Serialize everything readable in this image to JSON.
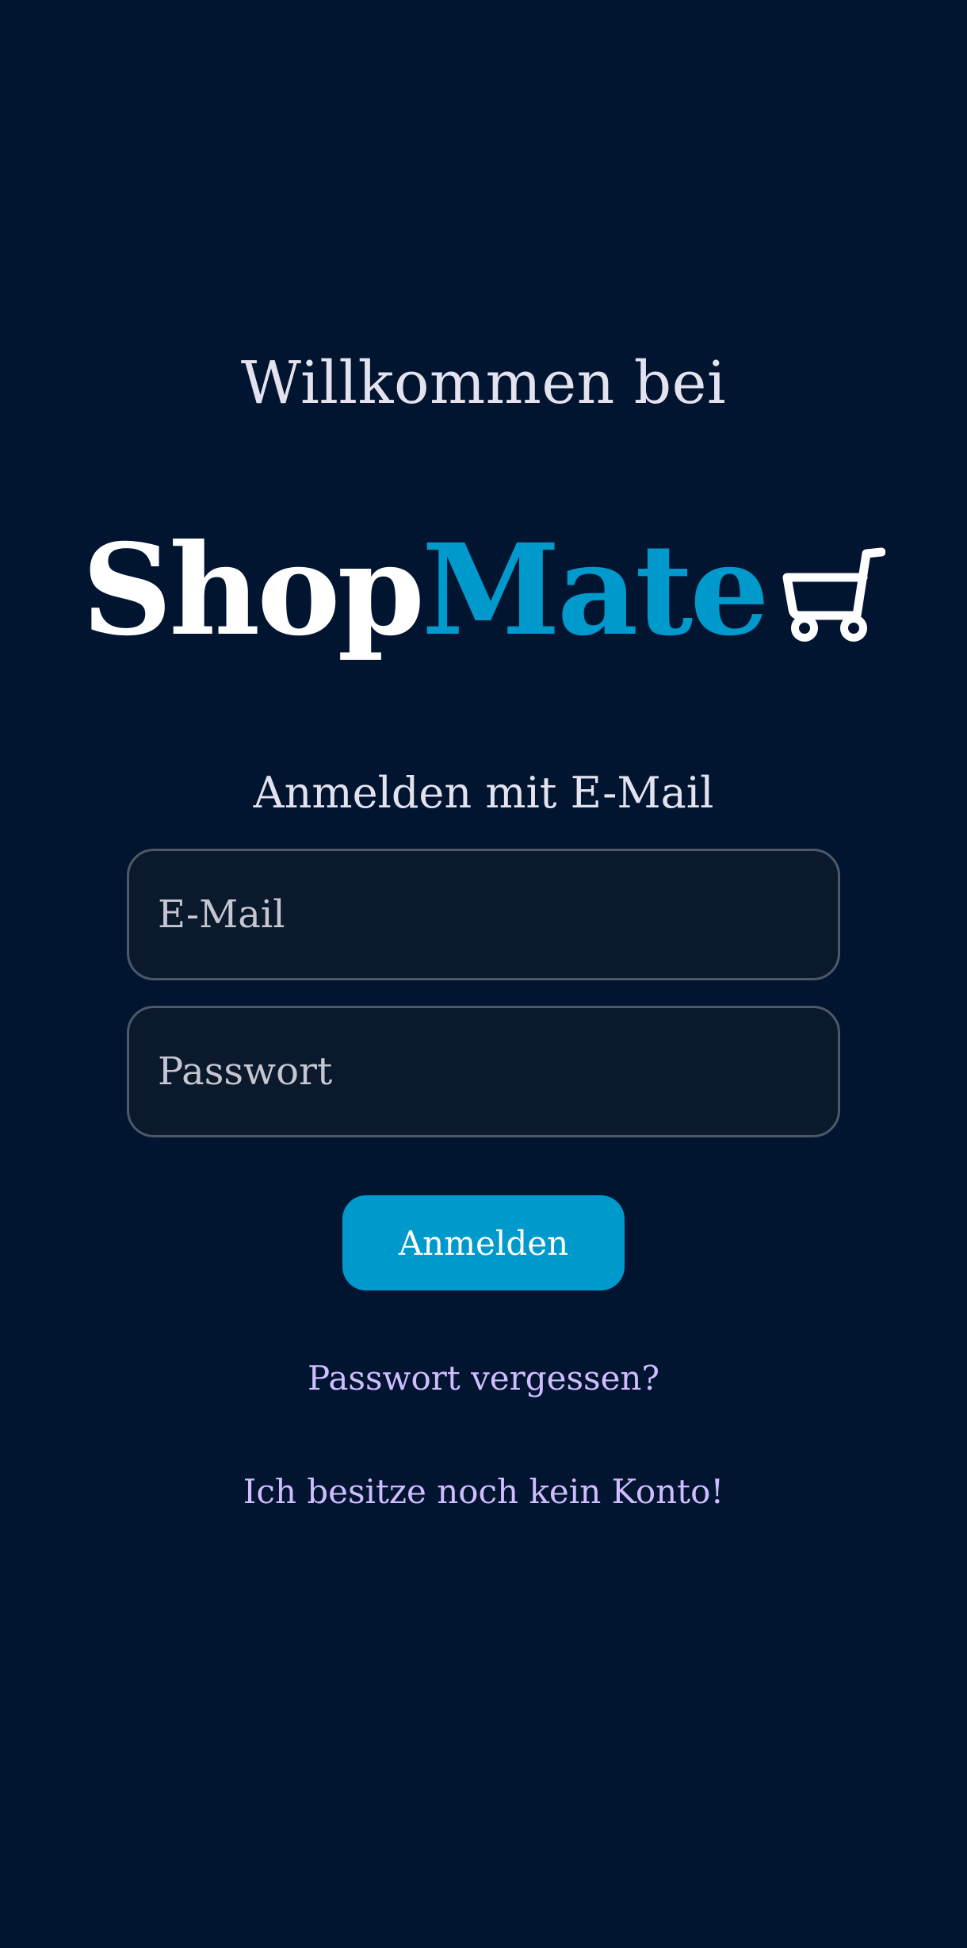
{
  "welcome": {
    "text": "Willkommen bei"
  },
  "logo": {
    "part1": "Shop",
    "part2": "Mate",
    "icon": "cart-icon"
  },
  "signin": {
    "heading": "Anmelden mit E-Mail"
  },
  "form": {
    "email": {
      "value": "",
      "placeholder": "E-Mail"
    },
    "password": {
      "value": "",
      "placeholder": "Passwort"
    },
    "submit_label": "Anmelden"
  },
  "links": {
    "forgot": "Passwort vergessen?",
    "register": "Ich besitze noch kein Konto!"
  },
  "colors": {
    "background": "#011530",
    "accent": "#0099cc",
    "link": "#d0bcff",
    "text": "#e4e2ef"
  }
}
